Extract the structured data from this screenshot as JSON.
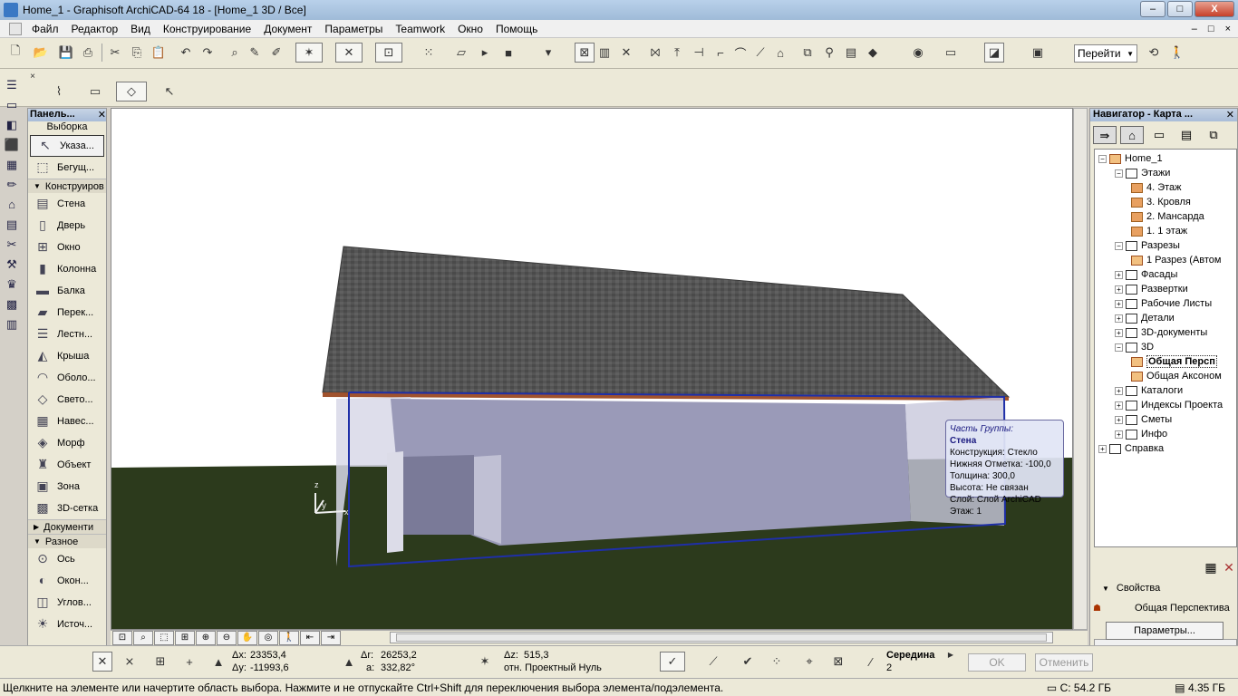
{
  "window": {
    "title": "Home_1 - Graphisoft ArchiCAD-64 18 - [Home_1 3D / Все]",
    "controls": {
      "minimize": "–",
      "maximize": "□",
      "close": "X"
    }
  },
  "menu": {
    "items": [
      "Файл",
      "Редактор",
      "Вид",
      "Конструирование",
      "Документ",
      "Параметры",
      "Teamwork",
      "Окно",
      "Помощь"
    ],
    "window_controls": {
      "minimize": "–",
      "restore": "□",
      "close": "×"
    }
  },
  "toolbar": {
    "goto_label": "Перейти"
  },
  "toolbox": {
    "title": "Панель...",
    "selection_label": "Выборка",
    "selection_tools": [
      {
        "label": "Указа...",
        "icon": "arrow-pointer-icon",
        "glyph": "↖"
      },
      {
        "label": "Бегущ...",
        "icon": "marquee-icon",
        "glyph": "⬚"
      }
    ],
    "group_construct": "Конструиров",
    "construct_tools": [
      {
        "label": "Стена",
        "icon": "wall-icon",
        "glyph": "▤"
      },
      {
        "label": "Дверь",
        "icon": "door-icon",
        "glyph": "▯"
      },
      {
        "label": "Окно",
        "icon": "window-icon",
        "glyph": "⊞"
      },
      {
        "label": "Колонна",
        "icon": "column-icon",
        "glyph": "▮"
      },
      {
        "label": "Балка",
        "icon": "beam-icon",
        "glyph": "▬"
      },
      {
        "label": "Перек...",
        "icon": "slab-icon",
        "glyph": "▰"
      },
      {
        "label": "Лестн...",
        "icon": "stair-icon",
        "glyph": "☰"
      },
      {
        "label": "Крыша",
        "icon": "roof-icon",
        "glyph": "◭"
      },
      {
        "label": "Оболо...",
        "icon": "shell-icon",
        "glyph": "◠"
      },
      {
        "label": "Свето...",
        "icon": "skylight-icon",
        "glyph": "◇"
      },
      {
        "label": "Навес...",
        "icon": "curtain-wall-icon",
        "glyph": "▦"
      },
      {
        "label": "Морф",
        "icon": "morph-icon",
        "glyph": "◈"
      },
      {
        "label": "Объект",
        "icon": "object-icon",
        "glyph": "♜"
      },
      {
        "label": "Зона",
        "icon": "zone-icon",
        "glyph": "▣"
      },
      {
        "label": "3D-сетка",
        "icon": "mesh-icon",
        "glyph": "▩"
      }
    ],
    "group_docs": "Документи",
    "group_misc": "Разное",
    "misc_tools": [
      {
        "label": "Ось",
        "icon": "grid-axis-icon",
        "glyph": "⊙"
      },
      {
        "label": "Окон...",
        "icon": "wall-end-icon",
        "glyph": "◐"
      },
      {
        "label": "Углов...",
        "icon": "corner-window-icon",
        "glyph": "◫"
      },
      {
        "label": "Источ...",
        "icon": "lamp-icon",
        "glyph": "☀"
      }
    ]
  },
  "tooltip": {
    "line1": "Часть Группы:",
    "line2": "Стена",
    "rows": [
      "Конструкция: Стекло",
      "Нижняя Отметка: -100,0",
      "Толщина: 300,0",
      "Высота: Не связан",
      "Слой: Слой ArchiCAD",
      "Этаж: 1"
    ]
  },
  "navigator": {
    "title": "Навигатор - Карта ...",
    "tree": [
      {
        "label": "Home_1",
        "level": 0,
        "icon": "house"
      },
      {
        "label": "Этажи",
        "level": 1,
        "icon": "folder"
      },
      {
        "label": "4. Этаж",
        "level": 2,
        "icon": "story"
      },
      {
        "label": "3. Кровля",
        "level": 2,
        "icon": "story"
      },
      {
        "label": "2. Мансарда",
        "level": 2,
        "icon": "story"
      },
      {
        "label": "1. 1 этаж",
        "level": 2,
        "icon": "story"
      },
      {
        "label": "Разрезы",
        "level": 1,
        "icon": "folder"
      },
      {
        "label": "1 Разрез (Автом",
        "level": 2,
        "icon": "house"
      },
      {
        "label": "Фасады",
        "level": 1,
        "icon": "folder"
      },
      {
        "label": "Развертки",
        "level": 1,
        "icon": "folder"
      },
      {
        "label": "Рабочие Листы",
        "level": 1,
        "icon": "folder"
      },
      {
        "label": "Детали",
        "level": 1,
        "icon": "folder"
      },
      {
        "label": "3D-документы",
        "level": 1,
        "icon": "folder"
      },
      {
        "label": "3D",
        "level": 1,
        "icon": "folder"
      },
      {
        "label": "Общая Персп",
        "level": 2,
        "icon": "camera",
        "selected": true
      },
      {
        "label": "Общая Аксоном",
        "level": 2,
        "icon": "cube"
      },
      {
        "label": "Каталоги",
        "level": 1,
        "icon": "folder"
      },
      {
        "label": "Индексы Проекта",
        "level": 1,
        "icon": "folder"
      },
      {
        "label": "Сметы",
        "level": 1,
        "icon": "folder"
      },
      {
        "label": "Инфо",
        "level": 1,
        "icon": "folder"
      },
      {
        "label": "Справка",
        "level": 0,
        "icon": "folder"
      }
    ],
    "properties_label": "Свойства",
    "current_view": "Общая Перспектива",
    "params_button": "Параметры..."
  },
  "infobox": {
    "dx_label": "Δx:",
    "dx": "23353,4",
    "dy_label": "Δy:",
    "dy": "-11993,6",
    "dr_label": "Δr:",
    "dr": "26253,2",
    "a_label": "a:",
    "a": "332,82°",
    "dz_label": "Δz:",
    "dz": "515,3",
    "ref_label": "отн. Проектный Нуль",
    "snap_label": "Середина",
    "snap_value": "2",
    "ok": "OK",
    "cancel": "Отменить"
  },
  "status": {
    "message": "Щелкните на элементе или начертите область выбора. Нажмите и не отпускайте Ctrl+Shift для переключения выбора элемента/подэлемента.",
    "disk": "C: 54.2 ГБ",
    "memory": "4.35 ГБ"
  },
  "axis_labels": {
    "z": "z",
    "y": "y",
    "x": "x"
  }
}
